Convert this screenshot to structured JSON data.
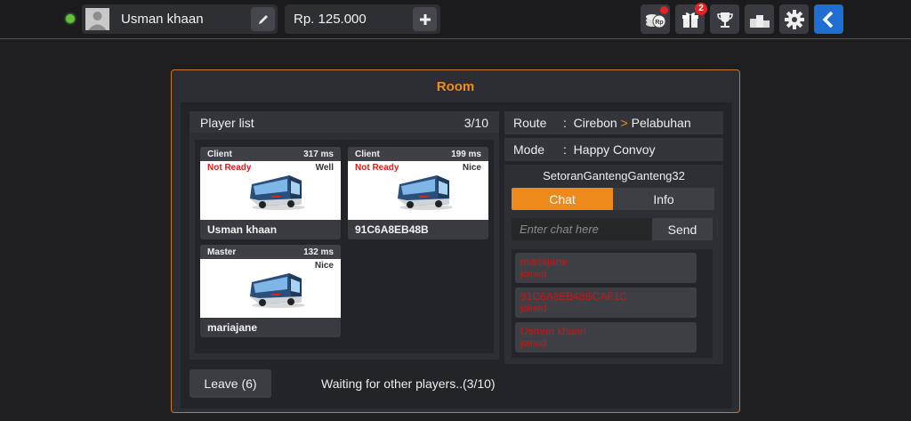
{
  "topbar": {
    "username": "Usman khaan",
    "money": "Rp. 125.000",
    "gift_badge": "2"
  },
  "room": {
    "title": "Room",
    "player_list": {
      "title": "Player list",
      "count": "3/10",
      "players": [
        {
          "role": "Client",
          "ping": "317 ms",
          "status": "Not Ready",
          "quality": "Well",
          "name": "Usman khaan"
        },
        {
          "role": "Client",
          "ping": "199 ms",
          "status": "Not Ready",
          "quality": "Nice",
          "name": "91C6A8EB48B"
        },
        {
          "role": "Master",
          "ping": "132 ms",
          "status": "",
          "quality": "Nice",
          "name": "mariajane"
        }
      ]
    },
    "leave_label": "Leave (6)",
    "waiting_text": "Waiting for other players..(3/10)",
    "route": {
      "label": "Route",
      "sep": ":",
      "from": "Cirebon",
      "arrow": ">",
      "to": "Pelabuhan"
    },
    "mode": {
      "label": "Mode",
      "sep": ":",
      "value": "Happy Convoy"
    },
    "room_name": "SetoranGantengGanteng32",
    "tabs": {
      "chat": "Chat",
      "info": "Info"
    },
    "chat_placeholder": "Enter chat here",
    "send_label": "Send",
    "messages": [
      {
        "name": "mariajane",
        "text": "joined"
      },
      {
        "name": "91C6A8EB48BCAF1C",
        "text": "joined"
      },
      {
        "name": "Usman khaan",
        "text": "joined"
      }
    ]
  },
  "colors": {
    "accent": "#f28c1c",
    "back": "#1f6fd1",
    "notready": "#e01818"
  }
}
